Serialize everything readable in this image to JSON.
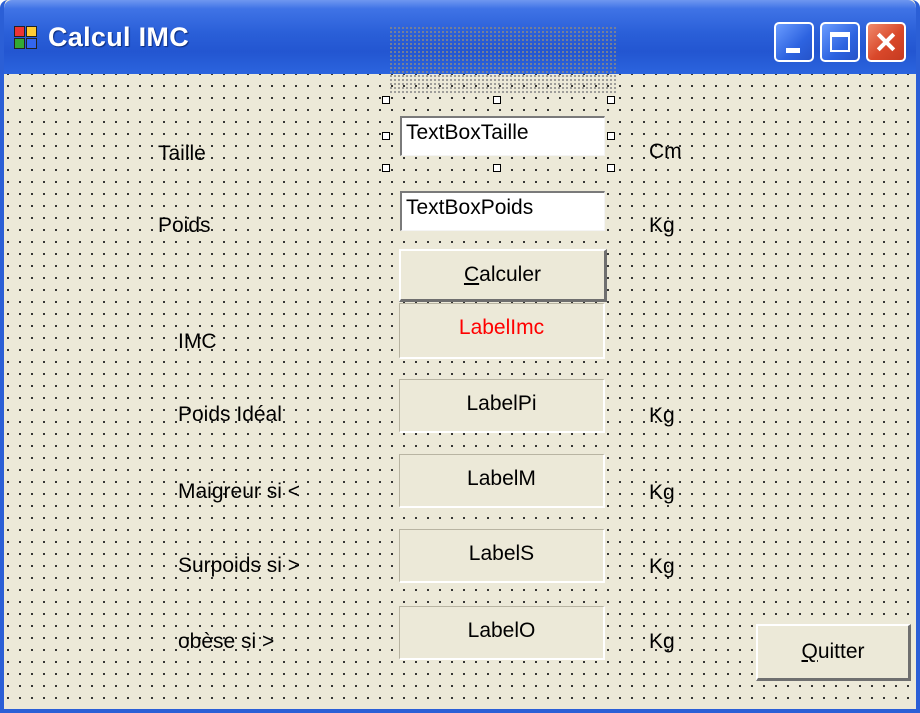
{
  "window": {
    "title": "Calcul IMC",
    "controls": {
      "minimize_icon": "minimize-icon",
      "maximize_icon": "maximize-icon",
      "close_icon": "close-icon"
    }
  },
  "form": {
    "taille": {
      "label": "Taille",
      "textbox": "TextBoxTaille",
      "unit": "Cm"
    },
    "poids": {
      "label": "Poids",
      "textbox": "TextBoxPoids",
      "unit": "Kg"
    },
    "calculer_button": {
      "prefix": "",
      "hotkey": "C",
      "rest": "alculer"
    },
    "imc": {
      "label": "IMC",
      "value_label": "LabelImc",
      "value_color": "#ff0000"
    },
    "poids_ideal": {
      "label": "Poids Idéal",
      "value_label": "LabelPi",
      "unit": "Kg"
    },
    "maigreur": {
      "label": "Maigreur si <",
      "value_label": "LabelM",
      "unit": "Kg"
    },
    "surpoids": {
      "label": "Surpoids si >",
      "value_label": "LabelS",
      "unit": "Kg"
    },
    "obese": {
      "label": "obèse si >",
      "value_label": "LabelO",
      "unit": "Kg"
    },
    "quitter_button": {
      "hotkey": "Q",
      "rest": "uitter"
    }
  },
  "colors": {
    "titlebar": "#2356d1",
    "form_bg": "#ece9d8",
    "accent_red": "#ff0000"
  }
}
